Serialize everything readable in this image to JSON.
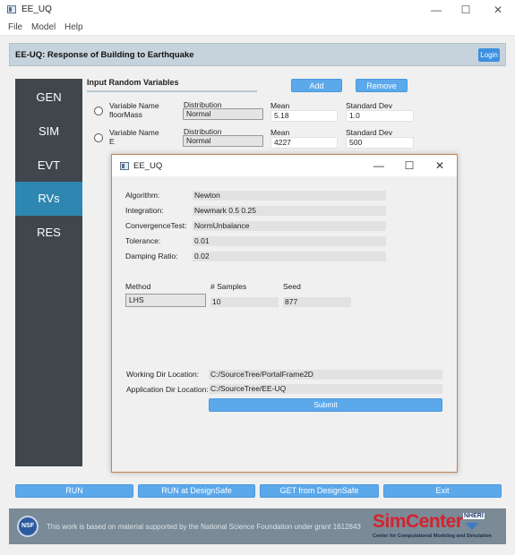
{
  "window": {
    "title": "EE_UQ",
    "minimize": "—",
    "maximize": "☐",
    "close": "✕"
  },
  "menu": [
    "File",
    "Model",
    "Help"
  ],
  "header": {
    "title": "EE-UQ: Response of Building to Earthquake",
    "login": "Login"
  },
  "sidebar": {
    "items": [
      "GEN",
      "SIM",
      "EVT",
      "RVs",
      "RES"
    ],
    "active": "RVs"
  },
  "rv_panel": {
    "title": "Input Random Variables",
    "add": "Add",
    "remove": "Remove",
    "headers": {
      "name": "Variable Name",
      "distribution": "Distribution",
      "mean": "Mean",
      "std": "Standard Dev"
    },
    "rows": [
      {
        "name": "floorMass",
        "distribution": "Normal",
        "mean": "5.18",
        "std": "1.0"
      },
      {
        "name": "E",
        "distribution": "Normal",
        "mean": "4227",
        "std": "500"
      }
    ]
  },
  "dialog": {
    "title": "EE_UQ",
    "fields": [
      {
        "label": "Algorithm:",
        "value": "Newton"
      },
      {
        "label": "Integration:",
        "value": "Newmark 0.5 0.25"
      },
      {
        "label": "ConvergenceTest:",
        "value": "NormUnbalance"
      },
      {
        "label": "Tolerance:",
        "value": "0.01"
      },
      {
        "label": "Damping Ratio:",
        "value": "0.02"
      }
    ],
    "method": {
      "label": "Method",
      "value": "LHS"
    },
    "samples": {
      "label": "# Samples",
      "value": "10"
    },
    "seed": {
      "label": "Seed",
      "value": "877"
    },
    "working_dir": {
      "label": "Working Dir Location:",
      "value": "C:/SourceTree/PortalFrame2D"
    },
    "app_dir": {
      "label": "Application Dir Location:",
      "value": "C:/SourceTree/EE-UQ"
    },
    "submit": "Submit"
  },
  "bottom_buttons": [
    "RUN",
    "RUN at DesignSafe",
    "GET from DesignSafe",
    "Exit"
  ],
  "footer": {
    "nsf": "NSF",
    "text": "This work is based on material supported by the National Science Foundation under grant 1612843",
    "brand": "SimCenter",
    "nheri": "NHERI",
    "brand_sub": "Center for Computational Modeling and Simulation"
  },
  "colors": {
    "accent": "#5ba8eb",
    "sidebar": "#3f464c",
    "active_nav": "#2e87b1",
    "brand_red": "#d2242f"
  }
}
